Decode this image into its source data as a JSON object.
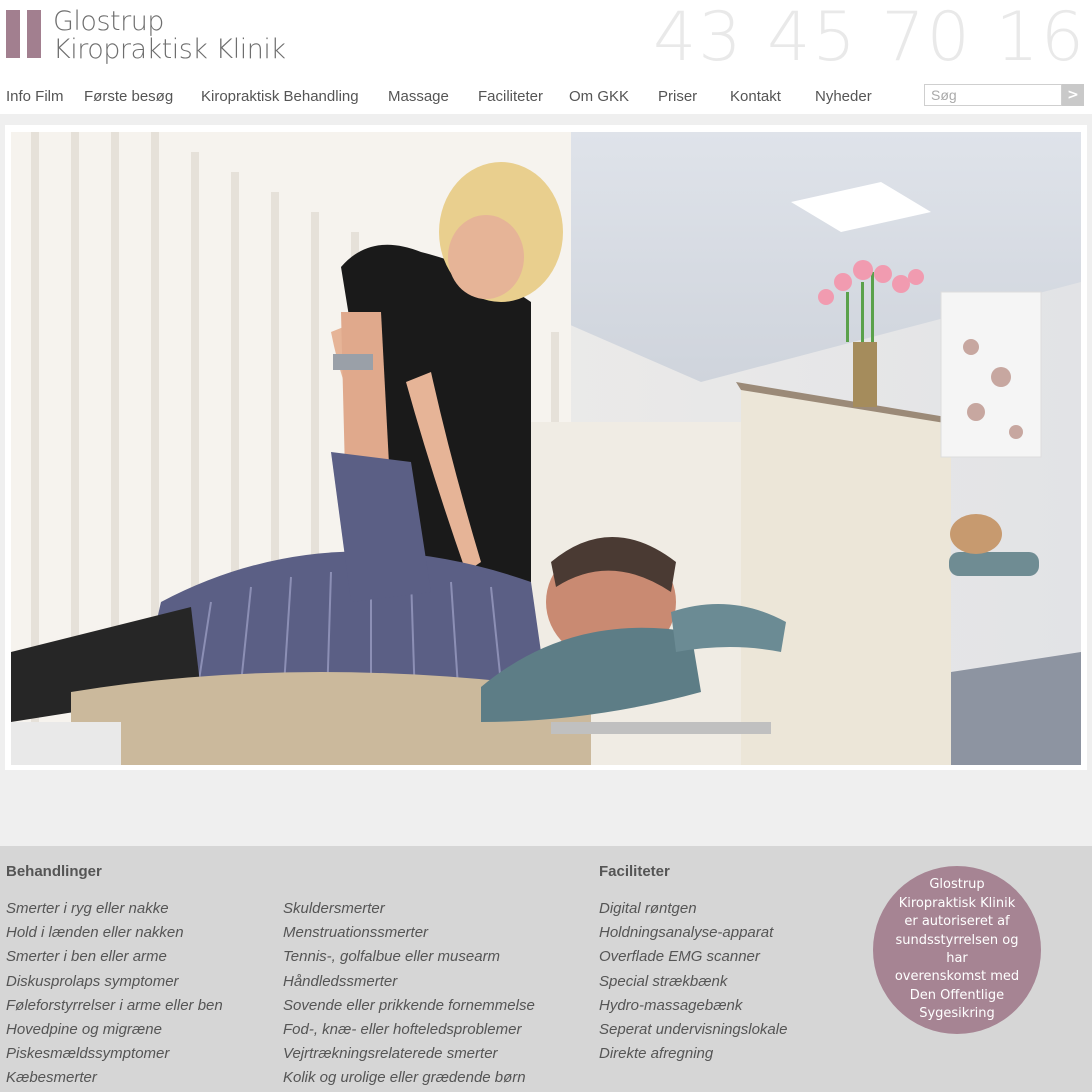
{
  "header": {
    "logo_line1": "Glostrup",
    "logo_line2": "Kiropraktisk Klinik",
    "phone": "43 45 70 16"
  },
  "nav": {
    "items": [
      "Info Film",
      "Første besøg",
      "Kiropraktisk Behandling",
      "Massage",
      "Faciliteter",
      "Om GKK",
      "Priser",
      "Kontakt",
      "Nyheder"
    ]
  },
  "search": {
    "placeholder": "Søg",
    "button": ">"
  },
  "footer": {
    "behandlinger_title": "Behandlinger",
    "behandlinger_col1": [
      "Smerter i ryg eller nakke",
      "Hold i lænden eller nakken",
      "Smerter i ben eller arme",
      "Diskusprolaps symptomer",
      "Føleforstyrrelser i arme eller ben",
      "Hovedpine og migræne",
      "Piskesmældssymptomer",
      "Kæbesmerter"
    ],
    "behandlinger_col2": [
      "Skuldersmerter",
      "Menstruationssmerter",
      "Tennis-, golfalbue eller musearm",
      "Håndledssmerter",
      "Sovende eller prikkende fornemmelse",
      "Fod-, knæ- eller hofteledsproblemer",
      "Vejrtrækningsrelaterede smerter",
      "Kolik og urolige eller grædende børn"
    ],
    "faciliteter_title": "Faciliteter",
    "faciliteter": [
      "Digital røntgen",
      "Holdningsanalyse-apparat",
      "Overflade EMG scanner",
      "Special strækbænk",
      "Hydro-massagebænk",
      "Seperat undervisningslokale",
      "Direkte afregning"
    ],
    "badge_lines": [
      "Glostrup",
      "Kiropraktisk Klinik",
      "er autoriseret af",
      "sundsstyrrelsen og har",
      "overenskomst med",
      "Den Offentlige",
      "Sygesikring"
    ]
  },
  "colors": {
    "brand": "#a27f8f",
    "badge": "#a68493",
    "footer_bg": "#d6d6d6"
  }
}
